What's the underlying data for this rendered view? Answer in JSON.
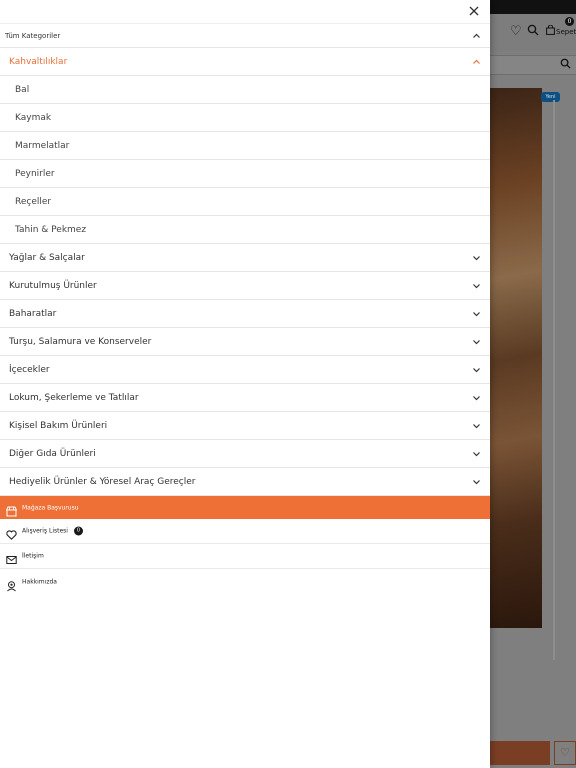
{
  "drawer": {
    "all_categories_label": "Tüm Kategoriler",
    "open_category": {
      "label": "Kahvaltılıklar",
      "items": [
        "Bal",
        "Kaymak",
        "Marmelatlar",
        "Peynirler",
        "Reçeller",
        "Tahin & Pekmez"
      ]
    },
    "categories": [
      "Yağlar & Salçalar",
      "Kurutulmuş Ürünler",
      "Baharatlar",
      "Turşu, Salamura ve Konserveler",
      "İçecekler",
      "Lokum, Şekerleme ve Tatlılar",
      "Kişisel Bakım Ürünleri",
      "Diğer Gıda Ürünleri",
      "Hediyelik Ürünler & Yöresel Araç Gereçler"
    ],
    "store_application_label": "Mağaza Başvurusu",
    "wishlist_label": "Alışveriş Listesi",
    "wishlist_count": "0",
    "contact_label": "İletişim",
    "about_label": "Hakkımızda"
  },
  "background": {
    "cart_label": "Sepet",
    "cart_count": "0",
    "product_badge": "Yeni"
  },
  "colors": {
    "accent": "#ee7036",
    "text": "#333333",
    "divider": "#e6e6e6"
  },
  "icons": {
    "close": "close-icon",
    "chevron_up": "chevron-up-icon",
    "chevron_down": "chevron-down-icon",
    "store": "store-icon",
    "heart": "heart-icon",
    "mail": "mail-icon",
    "about": "user-icon",
    "search": "search-icon",
    "cart": "bag-icon"
  }
}
